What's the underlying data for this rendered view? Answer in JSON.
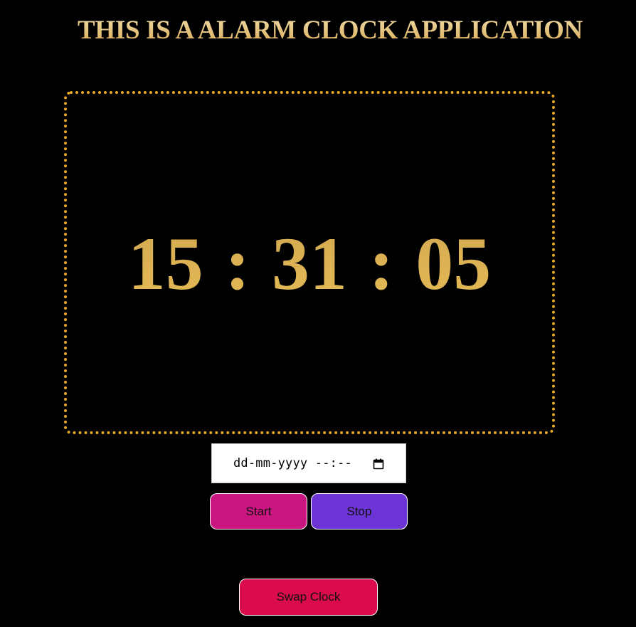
{
  "header": {
    "title": "THIS IS A ALARM CLOCK APPLICATION"
  },
  "clock": {
    "time": "15 : 31 : 05"
  },
  "alarm": {
    "input_placeholder": "dd-mm-yyyy --:--",
    "input_value": "",
    "calendar_icon": "calendar-icon"
  },
  "controls": {
    "start_label": "Start",
    "stop_label": "Stop",
    "swap_label": "Swap Clock"
  },
  "colors": {
    "background": "#000000",
    "gold": "#d4aa52",
    "frame_border": "#e8a92a",
    "start_button": "#c8157f",
    "stop_button": "#6c34d4",
    "swap_button": "#da0c4e"
  }
}
